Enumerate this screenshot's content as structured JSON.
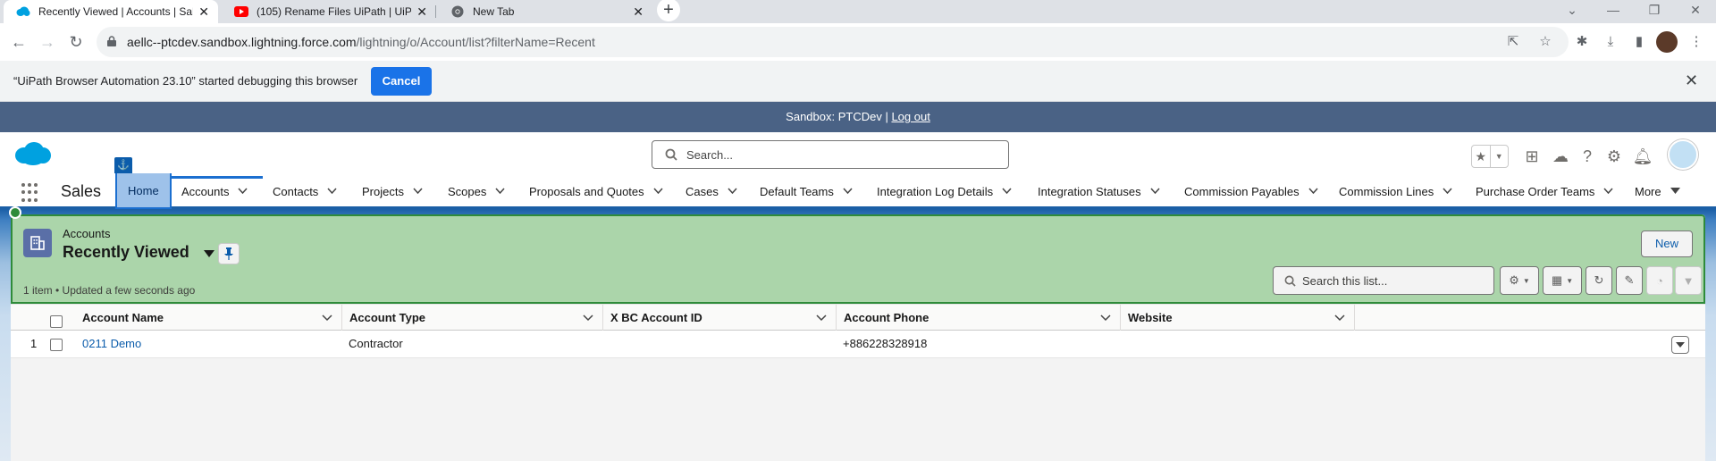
{
  "browser": {
    "tabs": [
      {
        "title": "Recently Viewed | Accounts | Sal",
        "active": true,
        "favicon": "salesforce-cloud-icon"
      },
      {
        "title": "(105) Rename Files UiPath | UiPa",
        "active": false,
        "favicon": "youtube-icon"
      },
      {
        "title": "New Tab",
        "active": false,
        "favicon": "chrome-icon"
      }
    ],
    "new_tab": "+",
    "url_host": "aellc--ptcdev.sandbox.lightning.force.com",
    "url_path": "/lightning/o/Account/list?filterName=Recent",
    "infobar_message": "“UiPath Browser Automation 23.10” started debugging this browser",
    "infobar_cancel": "Cancel"
  },
  "sandbox_banner": {
    "text": "Sandbox: PTCDev |",
    "logout": "Log out"
  },
  "header": {
    "search_placeholder": "Search..."
  },
  "app": {
    "name": "Sales",
    "nav_items": [
      {
        "label": "Home",
        "has_menu": false,
        "selected": true
      },
      {
        "label": "Accounts",
        "has_menu": true
      },
      {
        "label": "Contacts",
        "has_menu": true
      },
      {
        "label": "Projects",
        "has_menu": true
      },
      {
        "label": "Scopes",
        "has_menu": true
      },
      {
        "label": "Proposals and Quotes",
        "has_menu": true
      },
      {
        "label": "Cases",
        "has_menu": true
      },
      {
        "label": "Default Teams",
        "has_menu": true
      },
      {
        "label": "Integration Log Details",
        "has_menu": true
      },
      {
        "label": "Integration Statuses",
        "has_menu": true
      },
      {
        "label": "Commission Payables",
        "has_menu": true
      },
      {
        "label": "Commission Lines",
        "has_menu": true
      },
      {
        "label": "Purchase Order Teams",
        "has_menu": true
      },
      {
        "label": "More",
        "has_menu": true
      }
    ]
  },
  "list_view": {
    "object_label": "Accounts",
    "view_name": "Recently Viewed",
    "meta": "1 item • Updated a few seconds ago",
    "new_button": "New",
    "search_placeholder": "Search this list...",
    "columns": [
      "Account Name",
      "Account Type",
      "X BC Account ID",
      "Account Phone",
      "Website"
    ],
    "rows": [
      {
        "num": "1",
        "account_name": "0211 Demo",
        "account_type": "Contractor",
        "bc_account_id": "",
        "phone": "+886228328918",
        "website": ""
      }
    ]
  },
  "colors": {
    "salesforce_blue": "#0b5cab",
    "sandbox_banner": "#4a6285",
    "highlight_green": "#abd5aa",
    "highlight_border": "#2e8b3a",
    "infobar_button": "#1a73e8"
  }
}
